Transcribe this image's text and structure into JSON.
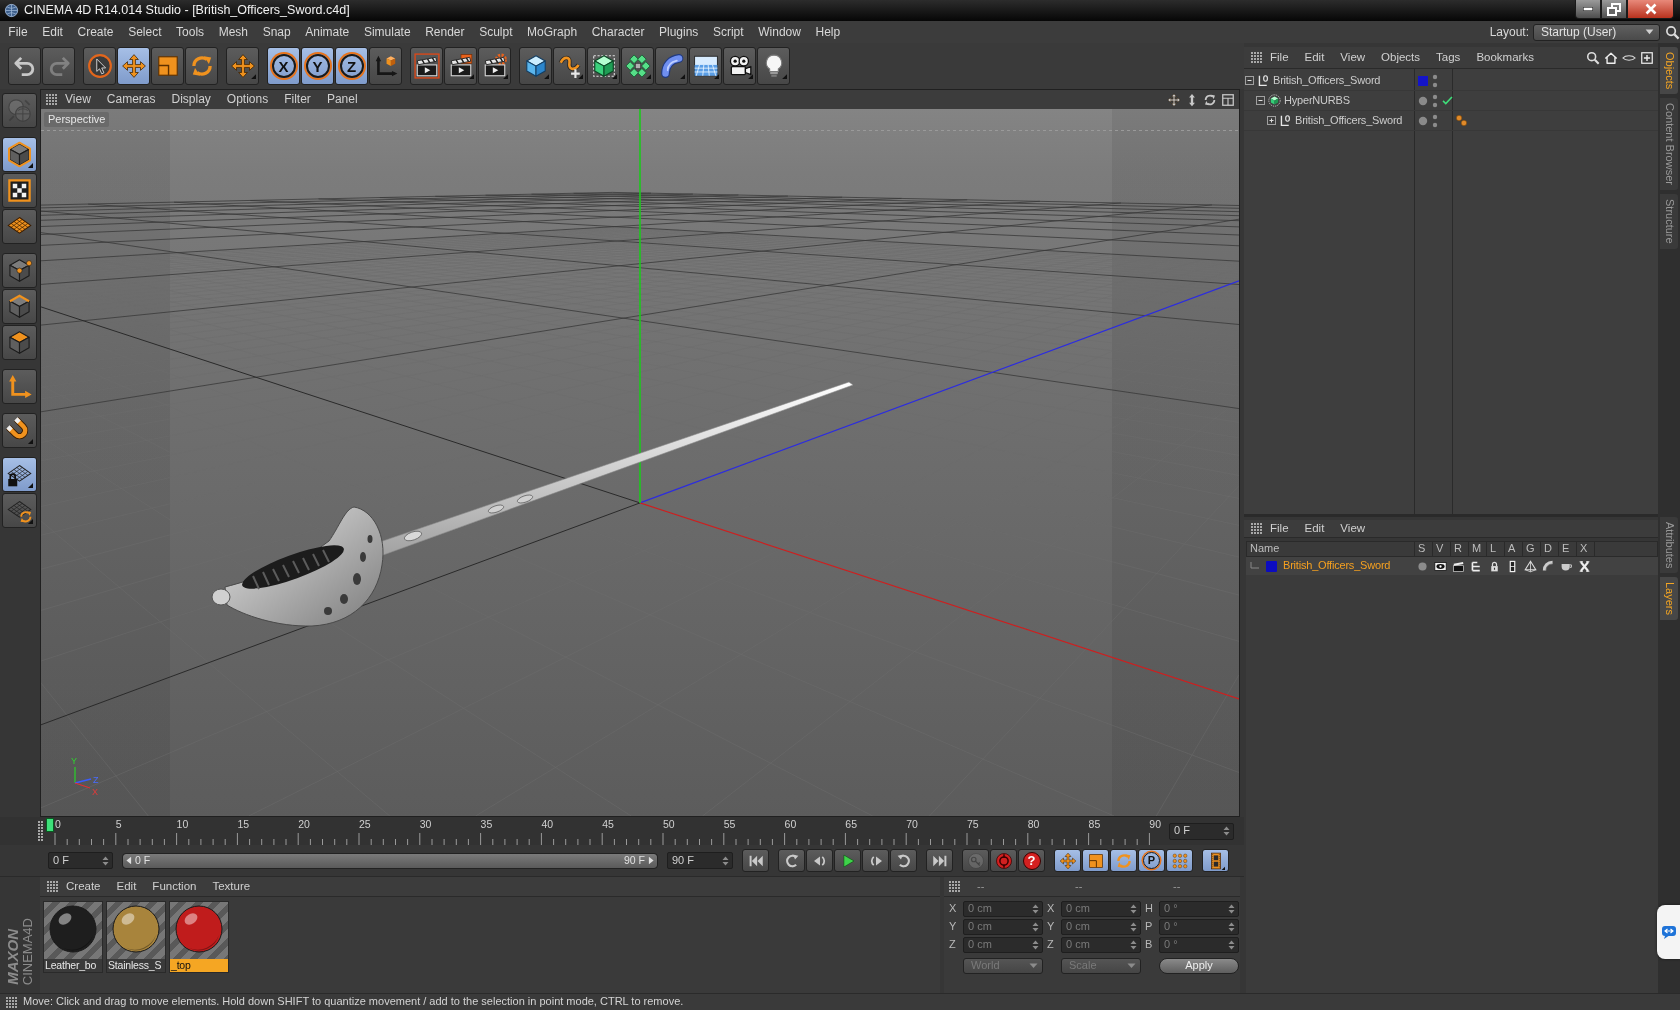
{
  "window": {
    "title": "CINEMA 4D R14.014 Studio - [British_Officers_Sword.c4d]"
  },
  "menu_bar": {
    "items": [
      "File",
      "Edit",
      "Create",
      "Select",
      "Tools",
      "Mesh",
      "Snap",
      "Animate",
      "Simulate",
      "Render",
      "Sculpt",
      "MoGraph",
      "Character",
      "Plugins",
      "Script",
      "Window",
      "Help"
    ],
    "layout_label": "Layout:",
    "layout_value": "Startup (User)"
  },
  "toolbar": {
    "groups": [
      [
        {
          "kind": "undo",
          "disabled": false
        },
        {
          "kind": "redo",
          "disabled": true
        }
      ],
      [
        {
          "kind": "select",
          "selected": false
        },
        {
          "kind": "move",
          "selected": true
        },
        {
          "kind": "scale",
          "selected": false
        },
        {
          "kind": "rotate",
          "selected": false
        }
      ],
      [
        {
          "kind": "recent",
          "selected": false
        }
      ],
      [
        {
          "kind": "axis",
          "label": "X",
          "selected": true
        },
        {
          "kind": "axis",
          "label": "Y",
          "selected": true
        },
        {
          "kind": "axis",
          "label": "Z",
          "selected": true
        },
        {
          "kind": "coords",
          "selected": false
        }
      ],
      [
        {
          "kind": "render-view"
        },
        {
          "kind": "render-picture"
        },
        {
          "kind": "render-settings"
        }
      ],
      [
        {
          "kind": "cube"
        },
        {
          "kind": "pen"
        },
        {
          "kind": "subdivision"
        },
        {
          "kind": "array"
        },
        {
          "kind": "bend"
        },
        {
          "kind": "floor"
        },
        {
          "kind": "camera"
        },
        {
          "kind": "light"
        }
      ]
    ]
  },
  "mode_bar": {
    "groups": [
      [
        {
          "kind": "make-editable",
          "disabled": true
        }
      ],
      [
        {
          "kind": "model",
          "selected": true
        },
        {
          "kind": "texture",
          "selected": false
        },
        {
          "kind": "workplane",
          "selected": false
        }
      ],
      [
        {
          "kind": "points",
          "selected": false
        },
        {
          "kind": "edges",
          "selected": false
        },
        {
          "kind": "polygons",
          "selected": false
        }
      ],
      [
        {
          "kind": "axis-mode",
          "selected": false
        }
      ],
      [
        {
          "kind": "snap",
          "selected": false
        }
      ],
      [
        {
          "kind": "lock-workplane",
          "selected": true
        },
        {
          "kind": "planar",
          "selected": false
        }
      ]
    ]
  },
  "viewport": {
    "menu": [
      "View",
      "Cameras",
      "Display",
      "Options",
      "Filter",
      "Panel"
    ],
    "camera": "Perspective",
    "gizmo_labels": [
      "Y",
      "Z",
      "X"
    ]
  },
  "timeline": {
    "ticks": [
      "0",
      "5",
      "10",
      "15",
      "20",
      "25",
      "30",
      "35",
      "40",
      "45",
      "50",
      "55",
      "60",
      "65",
      "70",
      "75",
      "80",
      "85",
      "90"
    ],
    "level": 0,
    "frame_field": "0 F"
  },
  "transport": {
    "start_field": "0 F",
    "range": {
      "start": "0 F",
      "end": "90 F",
      "level": 1
    },
    "end_field": "90 F",
    "groups": [
      [
        {
          "kind": "first"
        }
      ],
      [
        {
          "kind": "prev-key"
        },
        {
          "kind": "step-back"
        },
        {
          "kind": "play"
        },
        {
          "kind": "step-forward"
        },
        {
          "kind": "next-key"
        }
      ],
      [
        {
          "kind": "last"
        }
      ],
      [
        {
          "kind": "record-keys",
          "disabled": true
        },
        {
          "kind": "autokey",
          "disabled": false
        },
        {
          "kind": "key-selection",
          "label": "?",
          "disabled": false
        }
      ],
      [
        {
          "kind": "key-move",
          "selected": true
        },
        {
          "kind": "key-scale",
          "selected": true
        },
        {
          "kind": "key-rotate",
          "selected": true
        },
        {
          "kind": "key-param",
          "label": "P",
          "selected": true
        },
        {
          "kind": "key-points",
          "selected": true
        }
      ],
      [
        {
          "kind": "timeline",
          "selected": true
        }
      ]
    ]
  },
  "materials": {
    "menu": [
      "Create",
      "Edit",
      "Function",
      "Texture"
    ],
    "items": [
      {
        "name": "Leather_bo",
        "color": "#1e1e1e",
        "selected": false
      },
      {
        "name": "Stainless_S",
        "color": "#a8843c",
        "selected": false
      },
      {
        "name": "_top",
        "color": "#c01c1c",
        "selected": true
      }
    ]
  },
  "coordinates": {
    "disabled": true,
    "headers": [
      "--",
      "--",
      "--"
    ],
    "rows": [
      {
        "position_label": "X",
        "position": "0 cm",
        "size_label": "X",
        "size": "0 cm",
        "rotation_label": "H",
        "rotation": "0 °"
      },
      {
        "position_label": "Y",
        "position": "0 cm",
        "size_label": "Y",
        "size": "0 cm",
        "rotation_label": "P",
        "rotation": "0 °"
      },
      {
        "position_label": "Z",
        "position": "0 cm",
        "size_label": "Z",
        "size": "0 cm",
        "rotation_label": "B",
        "rotation": "0 °"
      }
    ],
    "mode": "World",
    "size_mode": "Scale",
    "apply": "Apply"
  },
  "objects": {
    "menu": [
      "File",
      "Edit",
      "View",
      "Objects",
      "Tags",
      "Bookmarks"
    ],
    "tree": [
      {
        "name": "British_Officers_Sword",
        "kind": "null",
        "expanded": true,
        "selected": false,
        "color": "#1414c8",
        "check": false,
        "children": [
          {
            "name": "HyperNURBS",
            "kind": "subdivision",
            "expanded": true,
            "selected": false,
            "check": true,
            "children": [
              {
                "name": "British_Officers_Sword",
                "kind": "null",
                "expanded": false,
                "selected": false,
                "check": false,
                "tags": [
                  {
                    "kind": "material"
                  }
                ]
              }
            ]
          }
        ]
      }
    ]
  },
  "layers": {
    "menu": [
      "File",
      "Edit",
      "View"
    ],
    "columns": [
      "Name",
      "S",
      "V",
      "R",
      "M",
      "L",
      "A",
      "G",
      "D",
      "E",
      "X"
    ],
    "rows": [
      {
        "name": "British_Officers_Sword",
        "color": "#0c0cc0",
        "selected": true
      }
    ]
  },
  "side_tabs": {
    "top": [
      {
        "label": "Objects",
        "selected": true
      },
      {
        "label": "Content Browser",
        "selected": false
      },
      {
        "label": "Structure",
        "selected": false
      }
    ],
    "bottom": [
      {
        "label": "Attributes",
        "selected": false
      },
      {
        "label": "Layers",
        "selected": true
      }
    ]
  },
  "logo": {
    "brand": "MAXON",
    "product": "CINEMA4D"
  },
  "status_bar": {
    "text": "Move: Click and drag to move elements. Hold down SHIFT to quantize movement / add to the selection in point mode, CTRL to remove."
  }
}
